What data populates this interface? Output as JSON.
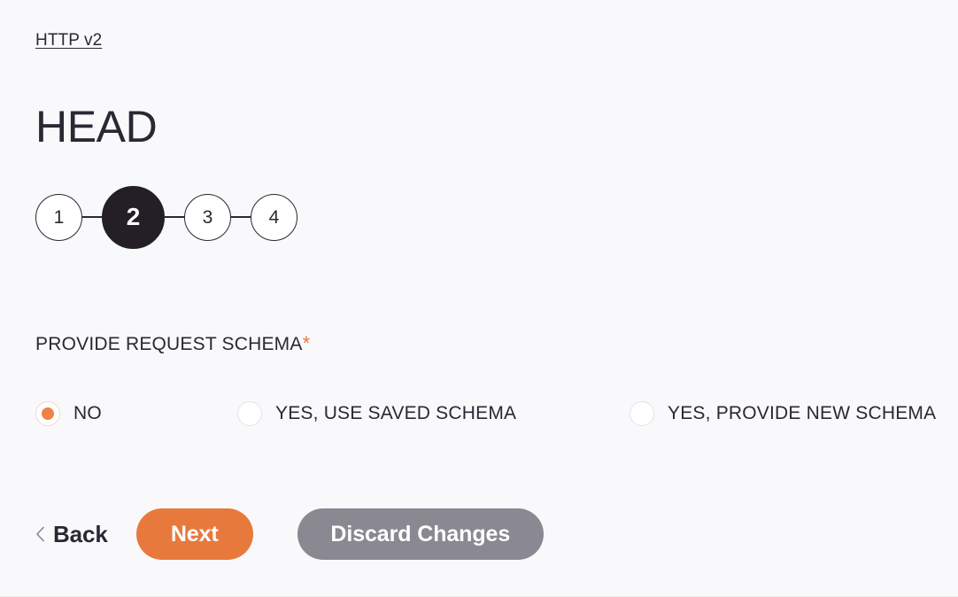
{
  "breadcrumb": {
    "label": "HTTP v2"
  },
  "header": {
    "title": "HEAD"
  },
  "stepper": {
    "current_step": 2,
    "steps": [
      {
        "number": "1",
        "active": false
      },
      {
        "number": "2",
        "active": true
      },
      {
        "number": "3",
        "active": false
      },
      {
        "number": "4",
        "active": false
      }
    ]
  },
  "form": {
    "field_label": "PROVIDE REQUEST SCHEMA",
    "required_marker": "*",
    "selected_value": "NO",
    "options": [
      {
        "label": "NO",
        "selected": true
      },
      {
        "label": "YES, USE SAVED SCHEMA",
        "selected": false
      },
      {
        "label": "YES, PROVIDE NEW SCHEMA",
        "selected": false
      }
    ]
  },
  "actions": {
    "back_label": "Back",
    "back_icon": "chevron-left-icon",
    "next_label": "Next",
    "discard_label": "Discard Changes"
  },
  "colors": {
    "background": "#f9f9fb",
    "accent": "#e8793d",
    "radio_dot": "#ee8348",
    "active_step": "#241f26",
    "secondary_button": "#8a8890",
    "text": "#2b2733"
  }
}
